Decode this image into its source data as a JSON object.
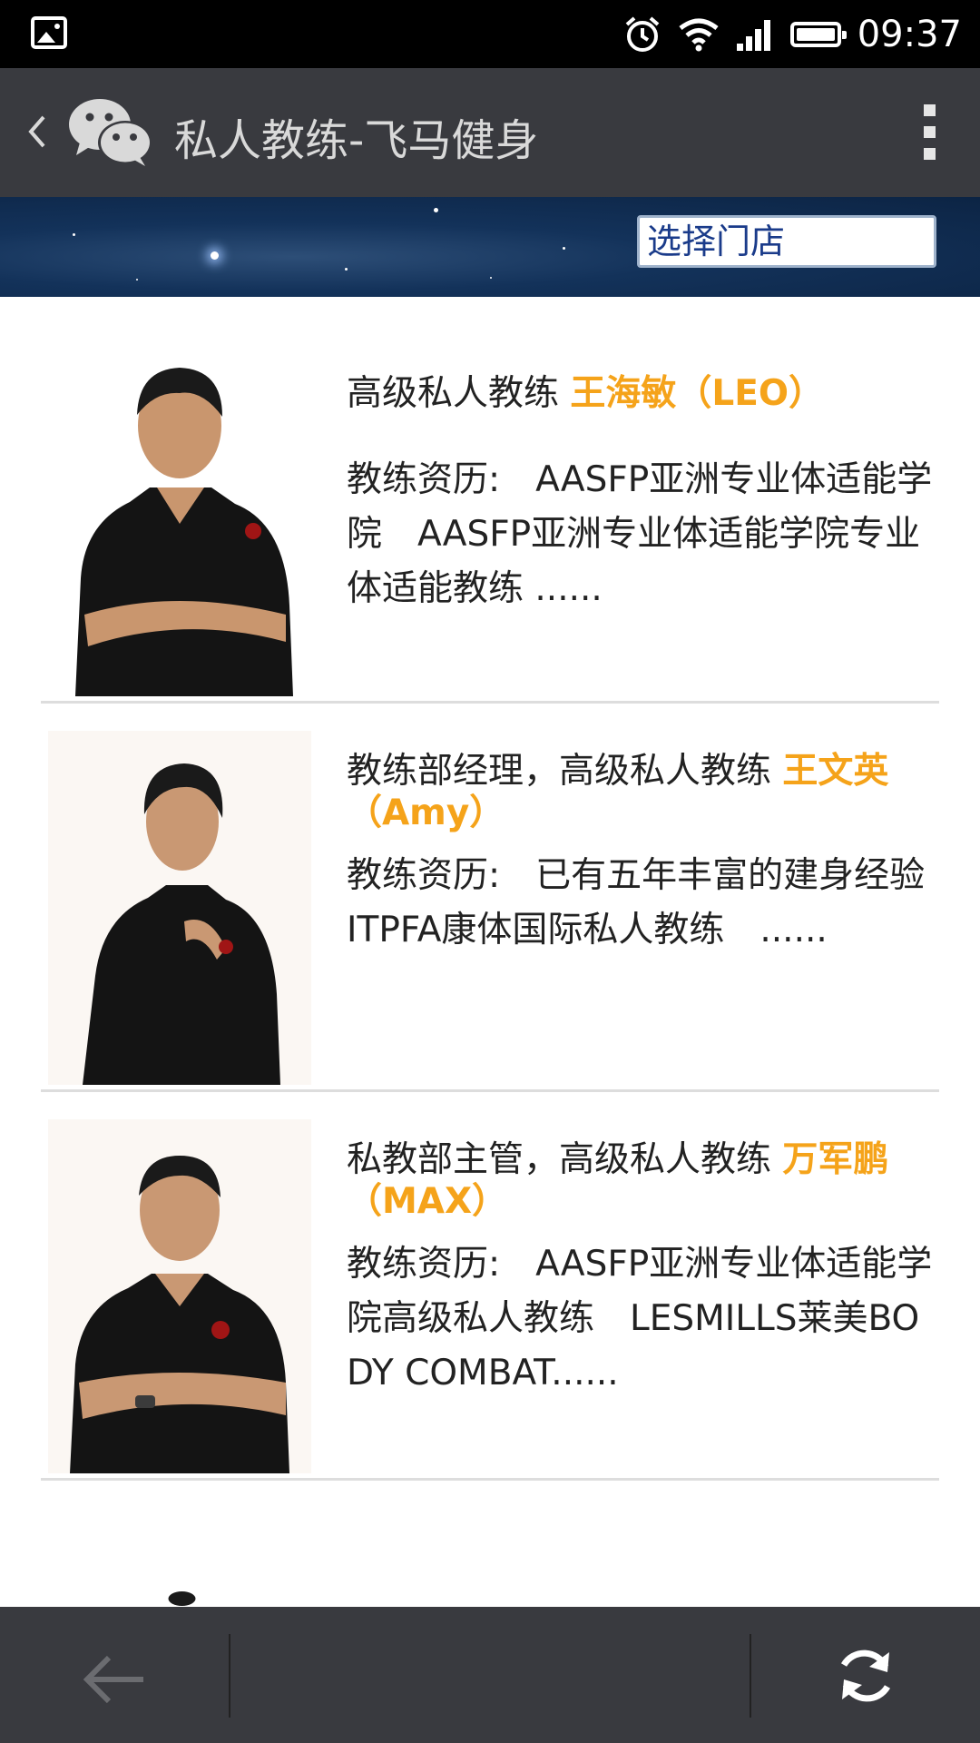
{
  "status_bar": {
    "time": "09:37",
    "icons": [
      "image-icon",
      "alarm-icon",
      "wifi-icon",
      "signal-icon",
      "battery-icon"
    ]
  },
  "app_bar": {
    "title": "私人教练-飞马健身",
    "icons": [
      "back-chevron-icon",
      "wechat-logo-icon",
      "more-vertical-icon"
    ]
  },
  "banner": {
    "store_select_value": "选择门店"
  },
  "coaches": [
    {
      "title_prefix": "高级私人教练 ",
      "name": "王海敏（LEO）",
      "bio": "教练资历:　AASFP亚洲专业体适能学院　AASFP亚洲专业体适能学院专业体适能教练 ......"
    },
    {
      "title_prefix": "教练部经理，高级私人教练 ",
      "name": "王文英（Amy）",
      "bio": "教练资历:　已有五年丰富的建身经验　ITPFA康体国际私人教练　......"
    },
    {
      "title_prefix": "私教部主管，高级私人教练 ",
      "name": "万军鹏（MAX）",
      "bio": "教练资历:　AASFP亚洲专业体适能学院高级私人教练　LESMILLS莱美BODY COMBAT......"
    }
  ],
  "colors": {
    "app_bar": "#393a3f",
    "accent_name": "#f5a31a",
    "banner": "#13325a"
  },
  "bottom_bar": {
    "icons": [
      "back-arrow-icon",
      "refresh-icon"
    ]
  }
}
